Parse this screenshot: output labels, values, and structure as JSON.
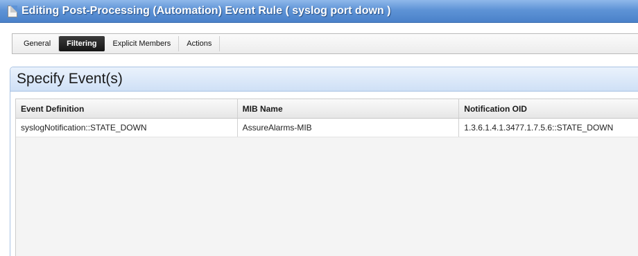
{
  "window": {
    "title": "Editing Post-Processing (Automation) Event Rule ( syslog port down )",
    "title_icon": "document-icon"
  },
  "tabs": [
    {
      "label": "General",
      "active": false
    },
    {
      "label": "Filtering",
      "active": true
    },
    {
      "label": "Explicit Members",
      "active": false
    },
    {
      "label": "Actions",
      "active": false
    }
  ],
  "panel": {
    "title": "Specify Event(s)"
  },
  "grid": {
    "columns": [
      "Event Definition",
      "MIB Name",
      "Notification OID"
    ],
    "rows": [
      [
        "syslogNotification::STATE_DOWN",
        "AssureAlarms-MIB",
        "1.3.6.1.4.1.3477.1.7.5.6::STATE_DOWN"
      ]
    ]
  },
  "colors": {
    "titlebar": "#5e93d6",
    "active_tab": "#151515",
    "panel_header": "#cfe0f6"
  }
}
